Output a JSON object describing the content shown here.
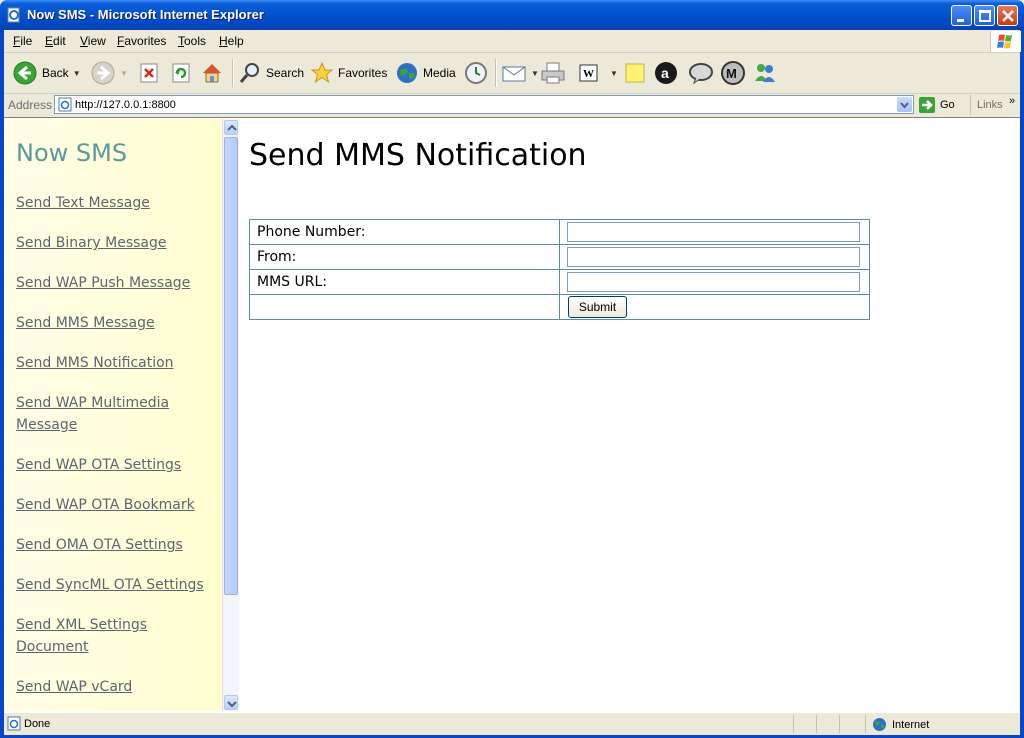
{
  "window": {
    "title": "Now SMS - Microsoft Internet Explorer"
  },
  "menu": [
    "File",
    "Edit",
    "View",
    "Favorites",
    "Tools",
    "Help"
  ],
  "toolbar": {
    "back": "Back",
    "search": "Search",
    "favorites": "Favorites",
    "media": "Media"
  },
  "address": {
    "label": "Address",
    "url": "http://127.0.0.1:8800",
    "go": "Go",
    "links": "Links"
  },
  "sidebar": {
    "brand": "Now SMS",
    "links": [
      "Send Text Message",
      "Send Binary Message",
      "Send WAP Push Message",
      "Send MMS Message",
      "Send MMS Notification",
      "Send WAP Multimedia Message",
      "Send WAP OTA Settings",
      "Send WAP OTA Bookmark",
      "Send OMA OTA Settings",
      "Send SyncML OTA Settings",
      "Send XML Settings Document",
      "Send WAP vCard"
    ]
  },
  "main": {
    "title": "Send MMS Notification",
    "fields": [
      {
        "label": "Phone Number:",
        "value": ""
      },
      {
        "label": "From:",
        "value": ""
      },
      {
        "label": "MMS URL:",
        "value": ""
      }
    ],
    "submit": "Submit"
  },
  "status": {
    "text": "Done",
    "zone": "Internet"
  },
  "colors": {
    "titlebar": "#0350d0",
    "brand": "#5b9a9a",
    "link": "#5c6570",
    "table_border": "#5b8f95"
  }
}
